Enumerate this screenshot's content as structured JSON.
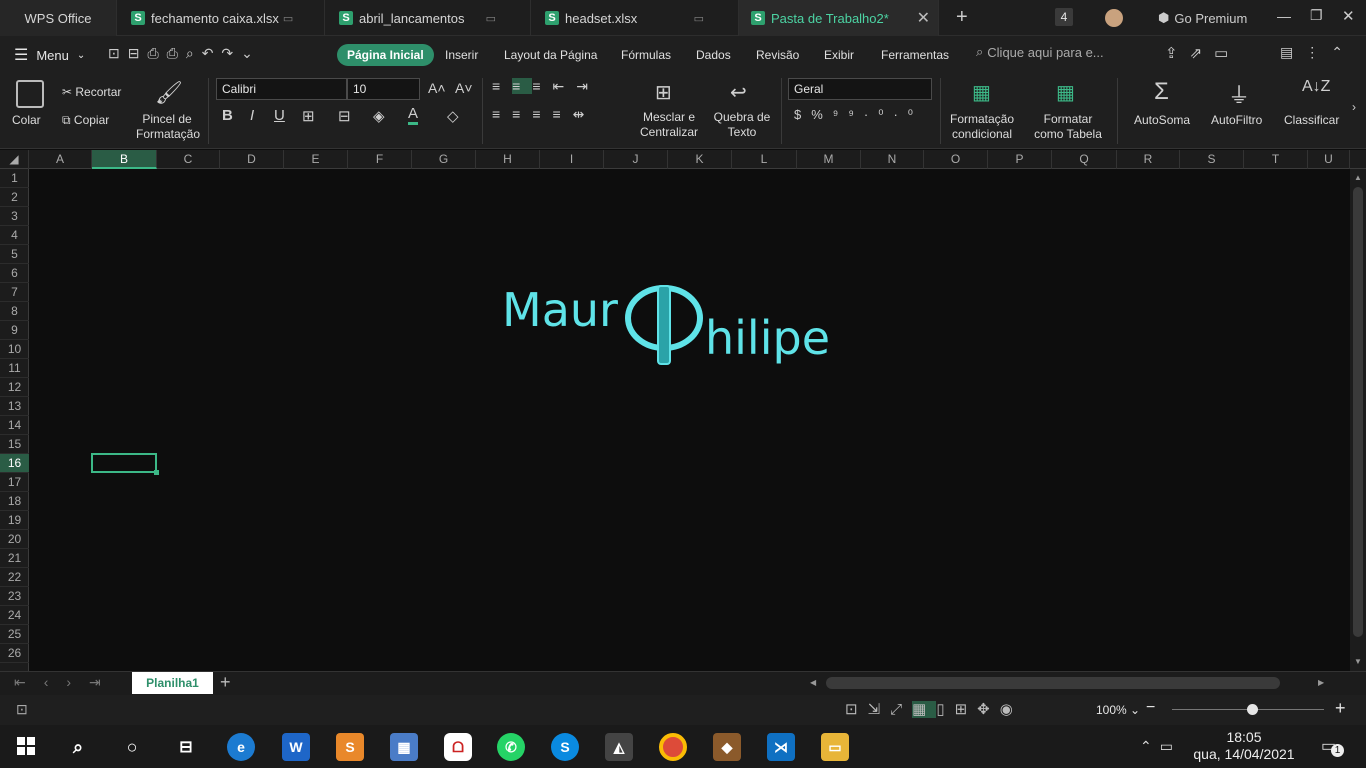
{
  "titlebar": {
    "app_tab": "WPS Office",
    "tabs": [
      {
        "label": "fechamento caixa.xlsx"
      },
      {
        "label": "abril_lancamentos"
      },
      {
        "label": "headset.xlsx"
      },
      {
        "label": "Pasta de Trabalho2*"
      }
    ],
    "tab_count": "4",
    "premium": "Go Premium"
  },
  "menubar": {
    "menu": "Menu",
    "tabs": [
      "Página Inicial",
      "Inserir",
      "Layout da Página",
      "Fórmulas",
      "Dados",
      "Revisão",
      "Exibir",
      "Ferramentas"
    ],
    "search_placeholder": "Clique aqui para e..."
  },
  "ribbon": {
    "colar": "Colar",
    "recortar": "Recortar",
    "copiar": "Copiar",
    "pincel": "Pincel de",
    "pincel2": "Formatação",
    "font": "Calibri",
    "size": "10",
    "mesclar": "Mesclar e",
    "mesclar2": "Centralizar",
    "quebra": "Quebra de",
    "quebra2": "Texto",
    "number_format": "Geral",
    "formatacao": "Formatação",
    "formatacao2": "condicional",
    "formatar": "Formatar",
    "formatar2": "como Tabela",
    "autosoma": "AutoSoma",
    "autofiltro": "AutoFiltro",
    "classificar": "Classificar"
  },
  "columns": [
    "A",
    "B",
    "C",
    "D",
    "E",
    "F",
    "G",
    "H",
    "I",
    "J",
    "K",
    "L",
    "M",
    "N",
    "O",
    "P",
    "Q",
    "R",
    "S",
    "T",
    "U"
  ],
  "rows": [
    "1",
    "2",
    "3",
    "4",
    "5",
    "6",
    "7",
    "8",
    "9",
    "10",
    "11",
    "12",
    "13",
    "14",
    "15",
    "16",
    "17",
    "18",
    "19",
    "20",
    "21",
    "22",
    "23",
    "24",
    "25",
    "26"
  ],
  "logo": {
    "part1": "Maur",
    "part2": "hilipe",
    "color": "#5fe3e8"
  },
  "sheet": {
    "name": "Planilha1"
  },
  "status": {
    "zoom": "100%",
    "zoom_level": 0.55
  },
  "taskbar": {
    "time": "18:05",
    "date": "qua, 14/04/2021",
    "notifications": "1"
  },
  "colors": {
    "accent": "#3cb887",
    "background": "#0d0d0d"
  }
}
